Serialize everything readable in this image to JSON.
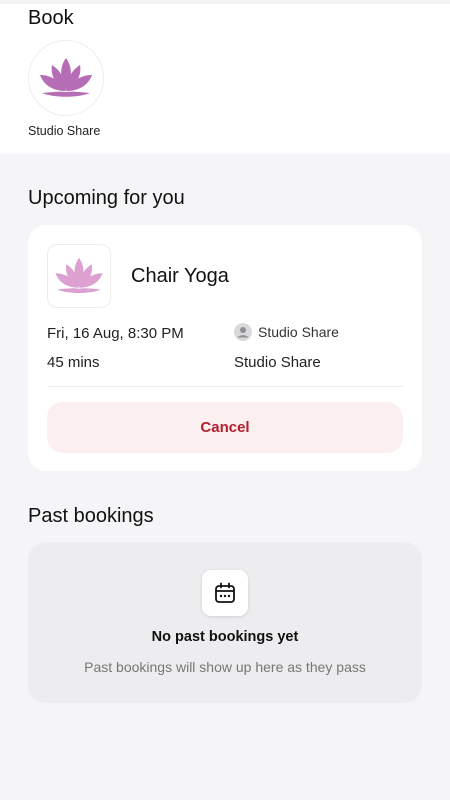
{
  "book": {
    "title": "Book",
    "studio": {
      "name": "Studio Share",
      "logo_icon": "lotus-icon",
      "accent": "#b56eb6"
    }
  },
  "upcoming": {
    "title": "Upcoming for you",
    "booking": {
      "class_name": "Chair Yoga",
      "logo_icon": "lotus-icon",
      "date_time": "Fri, 16 Aug, 8:30 PM",
      "duration": "45 mins",
      "host_icon": "user-icon",
      "host": "Studio Share",
      "location": "Studio Share",
      "cancel_label": "Cancel",
      "cancel_color": "#b31f2e"
    }
  },
  "past": {
    "title": "Past bookings",
    "empty_icon": "calendar-icon",
    "empty_title": "No past bookings yet",
    "empty_subtitle": "Past bookings will show up here as they pass"
  }
}
